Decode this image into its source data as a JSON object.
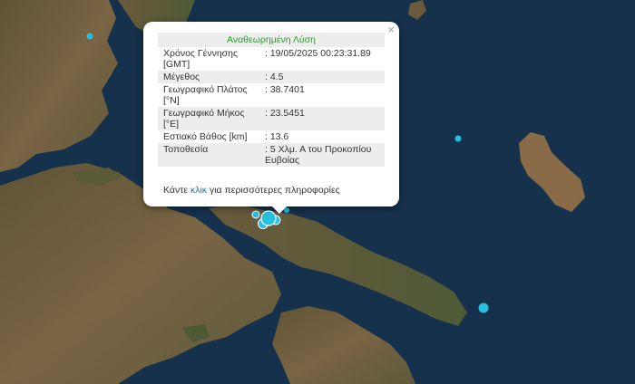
{
  "popup": {
    "title": "Αναθεωρημένη Λύση",
    "close": "×",
    "rows": [
      {
        "label": "Χρόνος Γέννησης [GMT]",
        "value": ": 19/05/2025 00:23:31.89"
      },
      {
        "label": "Μέγεθος",
        "value": ": 4.5"
      },
      {
        "label": "Γεωγραφικό Πλάτος [°N]",
        "value": ": 38.7401"
      },
      {
        "label": "Γεωγραφικό Μήκος [°E]",
        "value": ": 23.5451"
      },
      {
        "label": "Εστιακό Βάθος [km]",
        "value": ": 13.6"
      },
      {
        "label": "Τοποθεσία",
        "value": ": 5 Χλμ. Α του Προκοπίου Ευβοίας"
      }
    ],
    "more_prefix": "Κάντε",
    "more_link": "κλικ",
    "more_suffix": "για περισσότερες πληροφορίες"
  },
  "colors": {
    "sea": "#14304a",
    "land": "#6b5a3e",
    "marker": "#27bfe0",
    "marker_stroke": "#ffffff",
    "title_green": "#2e9b2e",
    "link_blue": "#1f6fb5"
  }
}
